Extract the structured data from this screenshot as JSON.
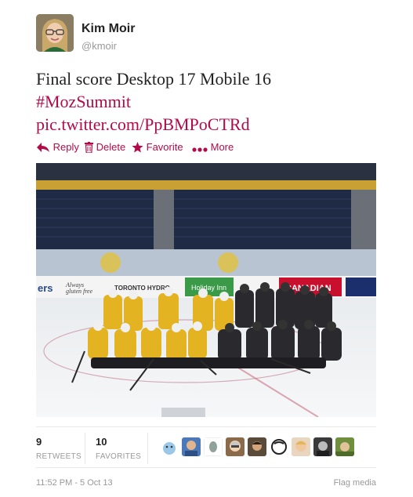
{
  "user": {
    "name": "Kim Moir",
    "handle": "@kmoir"
  },
  "tweet": {
    "text": "Final score Desktop 17 Mobile 16",
    "hashtag": "#MozSummit",
    "link": "pic.twitter.com/PpBMPoCTRd"
  },
  "actions": {
    "reply": "Reply",
    "delete": "Delete",
    "favorite": "Favorite",
    "more": "More"
  },
  "photo": {
    "subject": "hockey team group photo on ice rink",
    "board_ads": [
      "ers",
      "Always gluten free",
      "TORONTO HYDRO",
      "Holiday Inn Toronto",
      "MOLSON CANADIAN"
    ]
  },
  "stats": {
    "retweets": {
      "count": "9",
      "label": "RETWEETS"
    },
    "favorites": {
      "count": "10",
      "label": "FAVORITES"
    }
  },
  "footer": {
    "timestamp": "11:52 PM - 5 Oct 13",
    "flag": "Flag media"
  },
  "colors": {
    "link": "#b30b4a",
    "muted": "#999999"
  }
}
